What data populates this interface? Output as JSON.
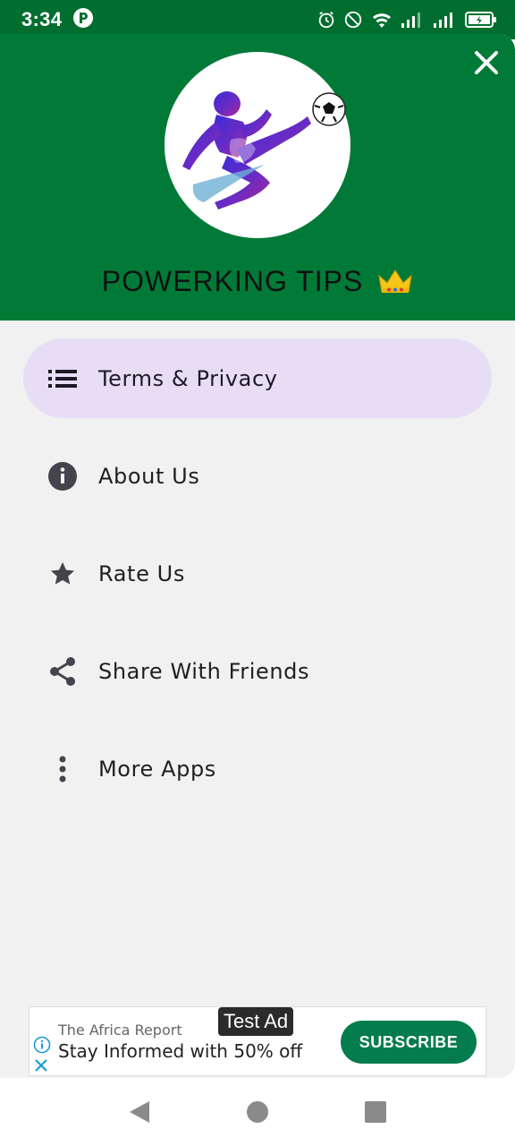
{
  "status_bar": {
    "time": "3:34",
    "icons": [
      "app-notification-icon",
      "alarm-icon",
      "do-not-disturb-icon",
      "wifi-icon",
      "signal-icon",
      "signal-icon",
      "battery-charging-icon"
    ]
  },
  "drawer": {
    "header_color": "#017a37",
    "app_title": "POWERKING TIPS",
    "title_emoji": "crown-icon",
    "menu": [
      {
        "label": "Terms & Privacy",
        "icon": "list-icon",
        "active": true
      },
      {
        "label": "About Us",
        "icon": "info-icon",
        "active": false
      },
      {
        "label": "Rate Us",
        "icon": "star-icon",
        "active": false
      },
      {
        "label": "Share With Friends",
        "icon": "share-icon",
        "active": false
      },
      {
        "label": "More Apps",
        "icon": "more-vert-icon",
        "active": false
      }
    ],
    "active_color": "#e7def5"
  },
  "ad": {
    "badge": "Test Ad",
    "advertiser": "The Africa Report",
    "headline": "Stay Informed with 50% off",
    "cta": "SUBSCRIBE",
    "cta_color": "#047c4d"
  },
  "nav_bar": {
    "buttons": [
      "back-icon",
      "home-icon",
      "recents-icon"
    ]
  }
}
